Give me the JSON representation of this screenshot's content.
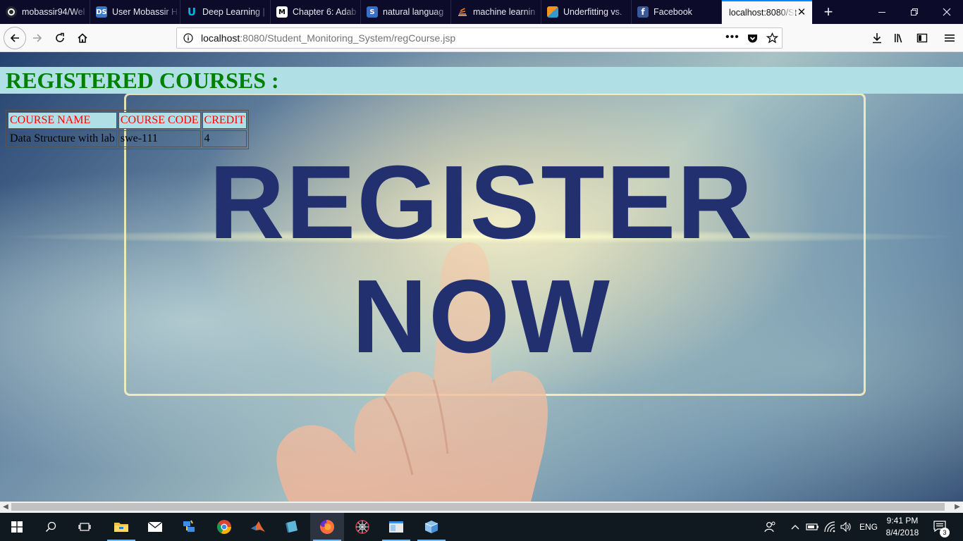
{
  "browser": {
    "tabs": [
      {
        "title": "mobassir94/Wel",
        "icon": "github-icon",
        "color": "#24292e"
      },
      {
        "title": "User Mobassir H",
        "icon": "datascience-icon",
        "color": "#3b77c4"
      },
      {
        "title": "Deep Learning |",
        "icon": "udacity-icon",
        "color": "#02b3e4"
      },
      {
        "title": "Chapter 6: Adab",
        "icon": "medium-icon",
        "color": "#000000"
      },
      {
        "title": "natural languag",
        "icon": "stats-stackexchange-icon",
        "color": "#3a6fc8"
      },
      {
        "title": "machine learnin",
        "icon": "stackoverflow-icon",
        "color": "#f48024"
      },
      {
        "title": "Underfitting vs.",
        "icon": "scikit-icon",
        "color": "#f7931e"
      },
      {
        "title": "Facebook",
        "icon": "facebook-icon",
        "color": "#3b5998"
      },
      {
        "title": "localhost:8080/St",
        "icon": "none",
        "color": "#f9f9fa",
        "active": true
      }
    ],
    "url_host": "localhost",
    "url_path": ":8080/Student_Monitoring_System/regCourse.jsp"
  },
  "page": {
    "heading": "REGISTERED COURSES :",
    "background_text_line1": "REGISTER",
    "background_text_line2": "NOW",
    "table": {
      "headers": [
        "COURSE NAME",
        "COURSE CODE",
        "CREDIT"
      ],
      "rows": [
        [
          "Data Structure with lab",
          "swe-111",
          "4"
        ]
      ]
    }
  },
  "taskbar": {
    "language": "ENG",
    "time": "9:41 PM",
    "date": "8/4/2018",
    "notification_count": "3"
  }
}
